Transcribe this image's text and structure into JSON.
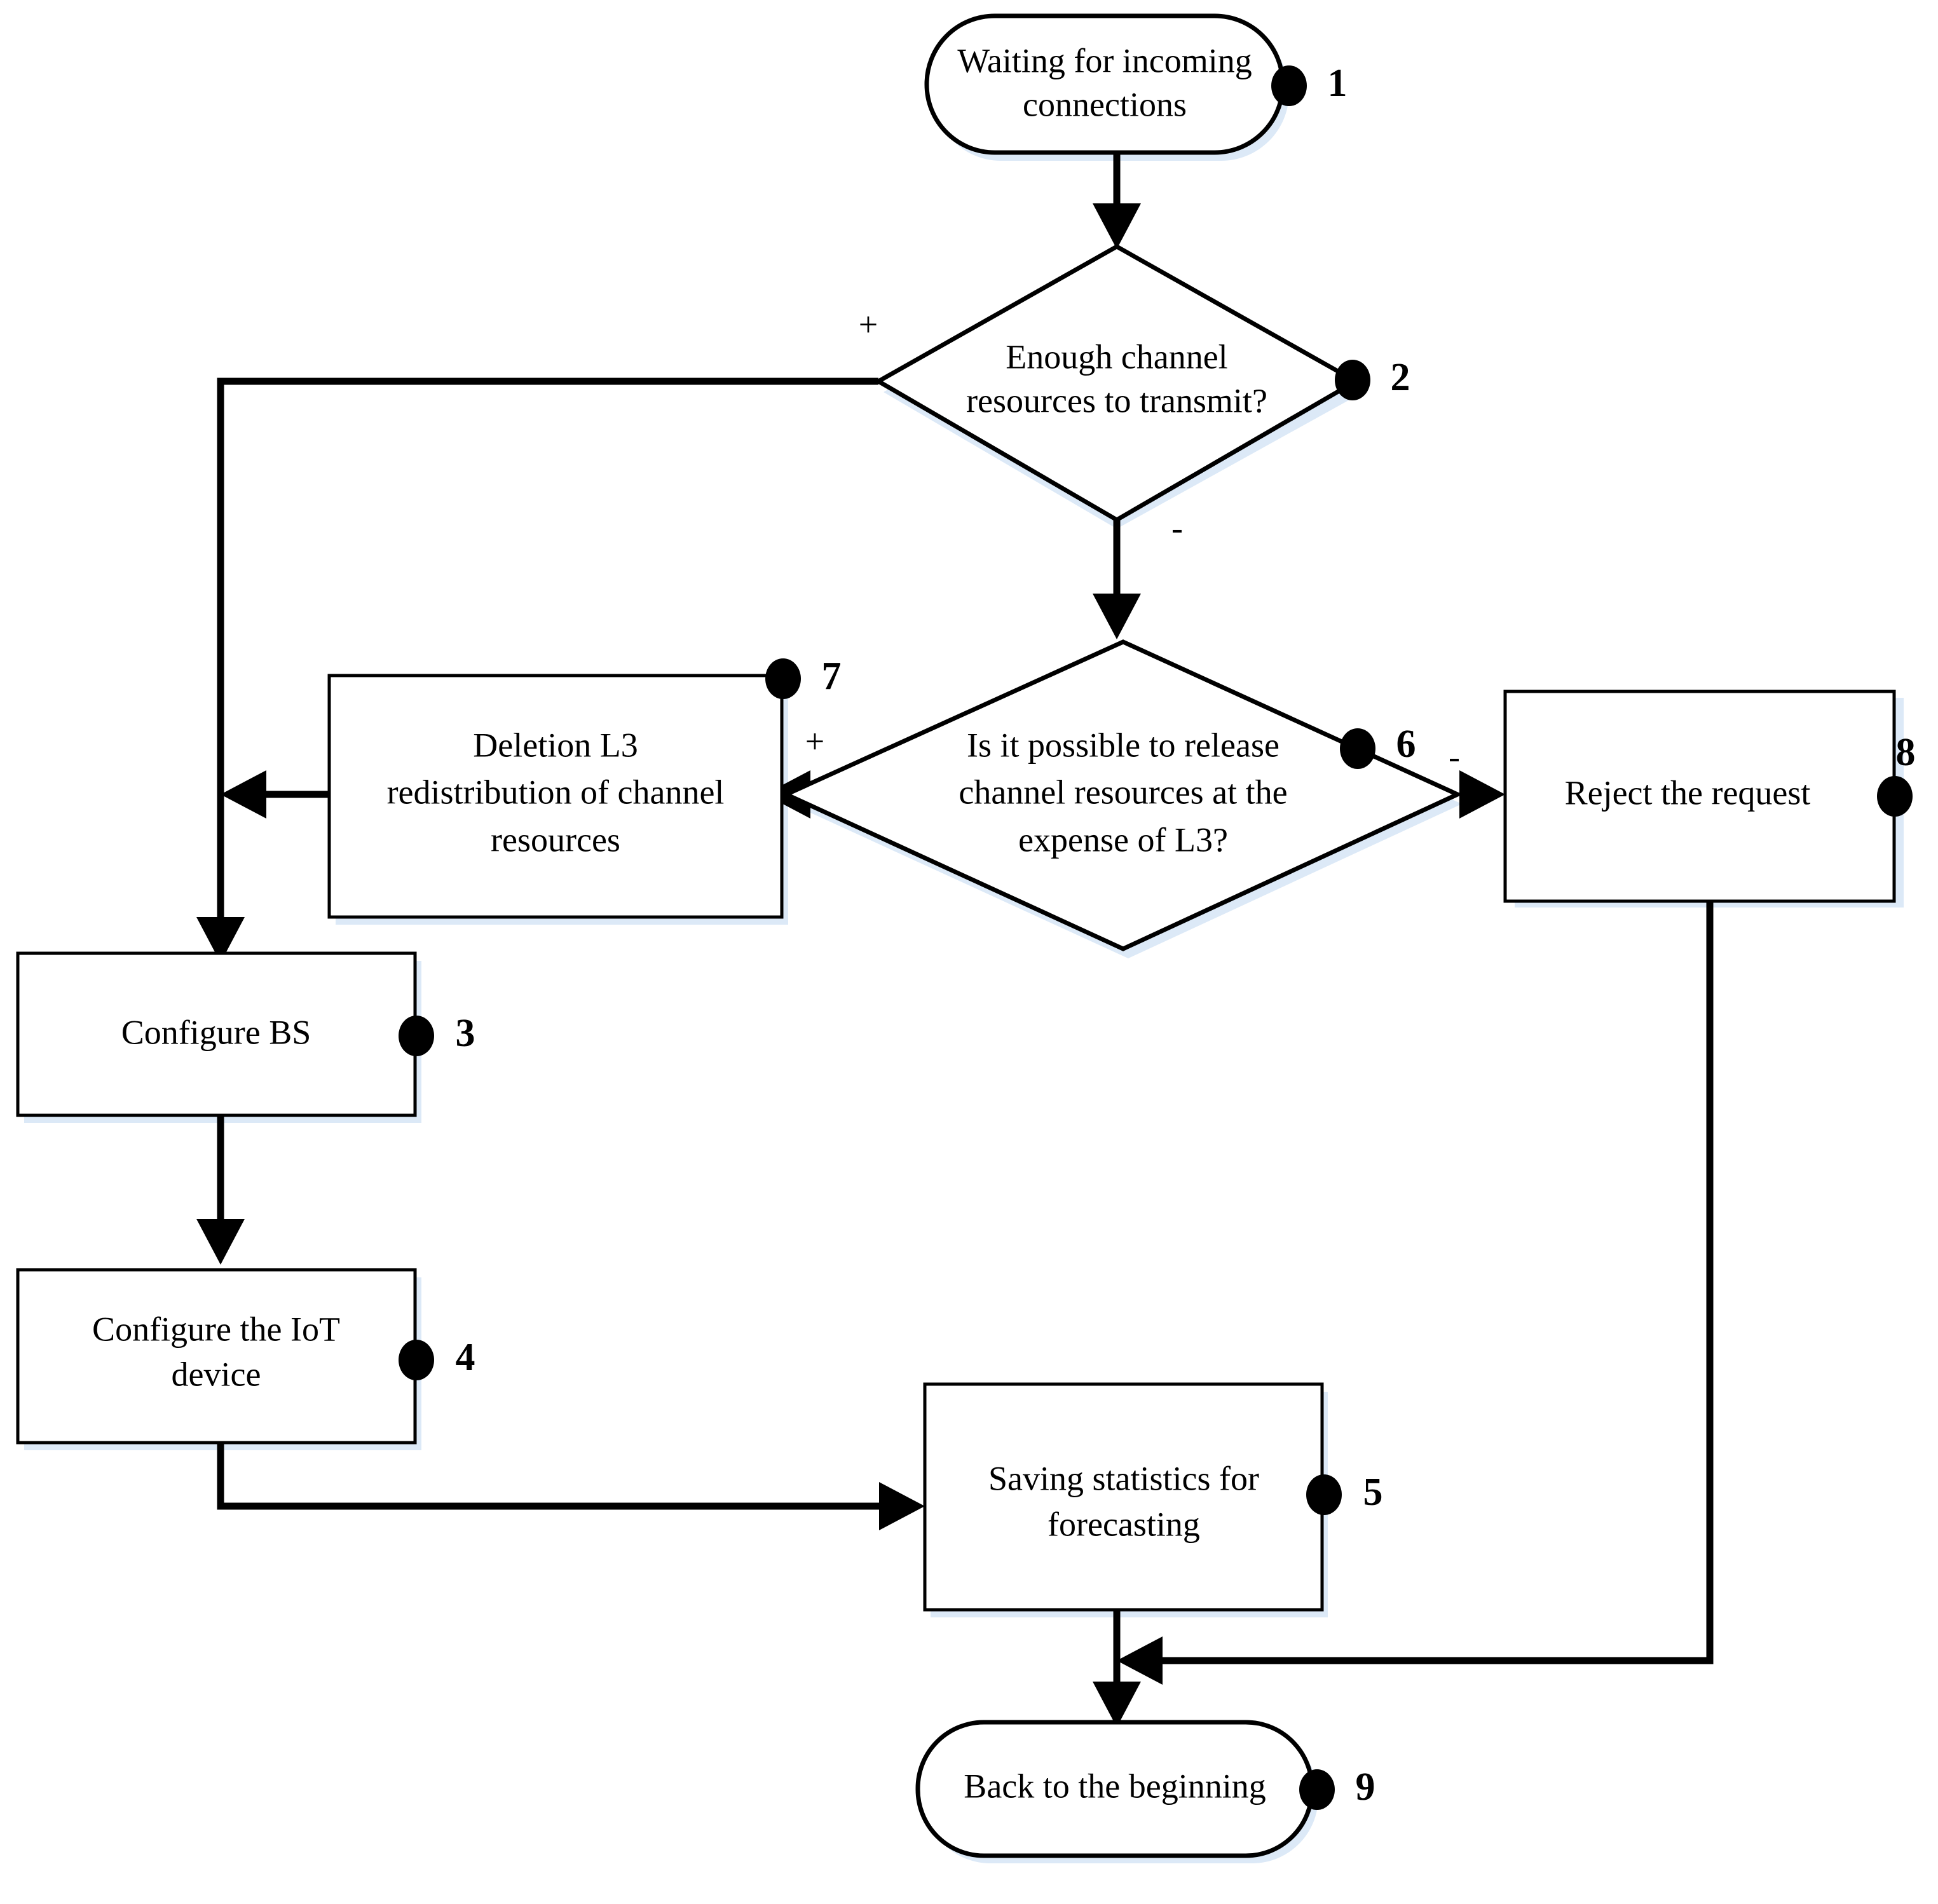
{
  "diagram": {
    "type": "flowchart",
    "orientation": "top-down",
    "background_color": "#ffffff",
    "line_color": "#000000",
    "shadow_color": "#dce9f7",
    "nodes": [
      {
        "id": 1,
        "marker": "1",
        "shape": "terminator",
        "lines": [
          "Waiting for incoming",
          "connections"
        ]
      },
      {
        "id": 2,
        "marker": "2",
        "shape": "decision",
        "lines": [
          "Enough channel",
          "resources to transmit?"
        ]
      },
      {
        "id": 7,
        "marker": "7",
        "shape": "process",
        "lines": [
          "Deletion L3",
          "redistribution of channel",
          "resources"
        ]
      },
      {
        "id": 6,
        "marker": "6",
        "shape": "decision",
        "lines": [
          "Is it possible to release",
          "channel resources at the",
          "expense of L3?"
        ]
      },
      {
        "id": 8,
        "marker": "8",
        "shape": "process",
        "lines": [
          "Reject the request"
        ]
      },
      {
        "id": 3,
        "marker": "3",
        "shape": "process",
        "lines": [
          "Configure BS"
        ]
      },
      {
        "id": 4,
        "marker": "4",
        "shape": "process",
        "lines": [
          "Configure the IoT",
          "device"
        ]
      },
      {
        "id": 5,
        "marker": "5",
        "shape": "process",
        "lines": [
          "Saving statistics for",
          "forecasting"
        ]
      },
      {
        "id": 9,
        "marker": "9",
        "shape": "terminator",
        "lines": [
          "Back to the beginning"
        ]
      }
    ],
    "branch_labels": {
      "d2_positive": "+",
      "d2_negative": "-",
      "d6_positive": "+",
      "d6_negative": "-"
    },
    "edges": [
      {
        "from": 1,
        "to": 2,
        "label": ""
      },
      {
        "from": 2,
        "to": 3,
        "label": "+"
      },
      {
        "from": 2,
        "to": 6,
        "label": "-"
      },
      {
        "from": 6,
        "to": 7,
        "label": "+"
      },
      {
        "from": 6,
        "to": 8,
        "label": "-"
      },
      {
        "from": 7,
        "to": 3,
        "label": ""
      },
      {
        "from": 3,
        "to": 4,
        "label": ""
      },
      {
        "from": 4,
        "to": 5,
        "label": ""
      },
      {
        "from": 5,
        "to": 9,
        "label": ""
      },
      {
        "from": 8,
        "to": 9,
        "label": ""
      }
    ]
  }
}
